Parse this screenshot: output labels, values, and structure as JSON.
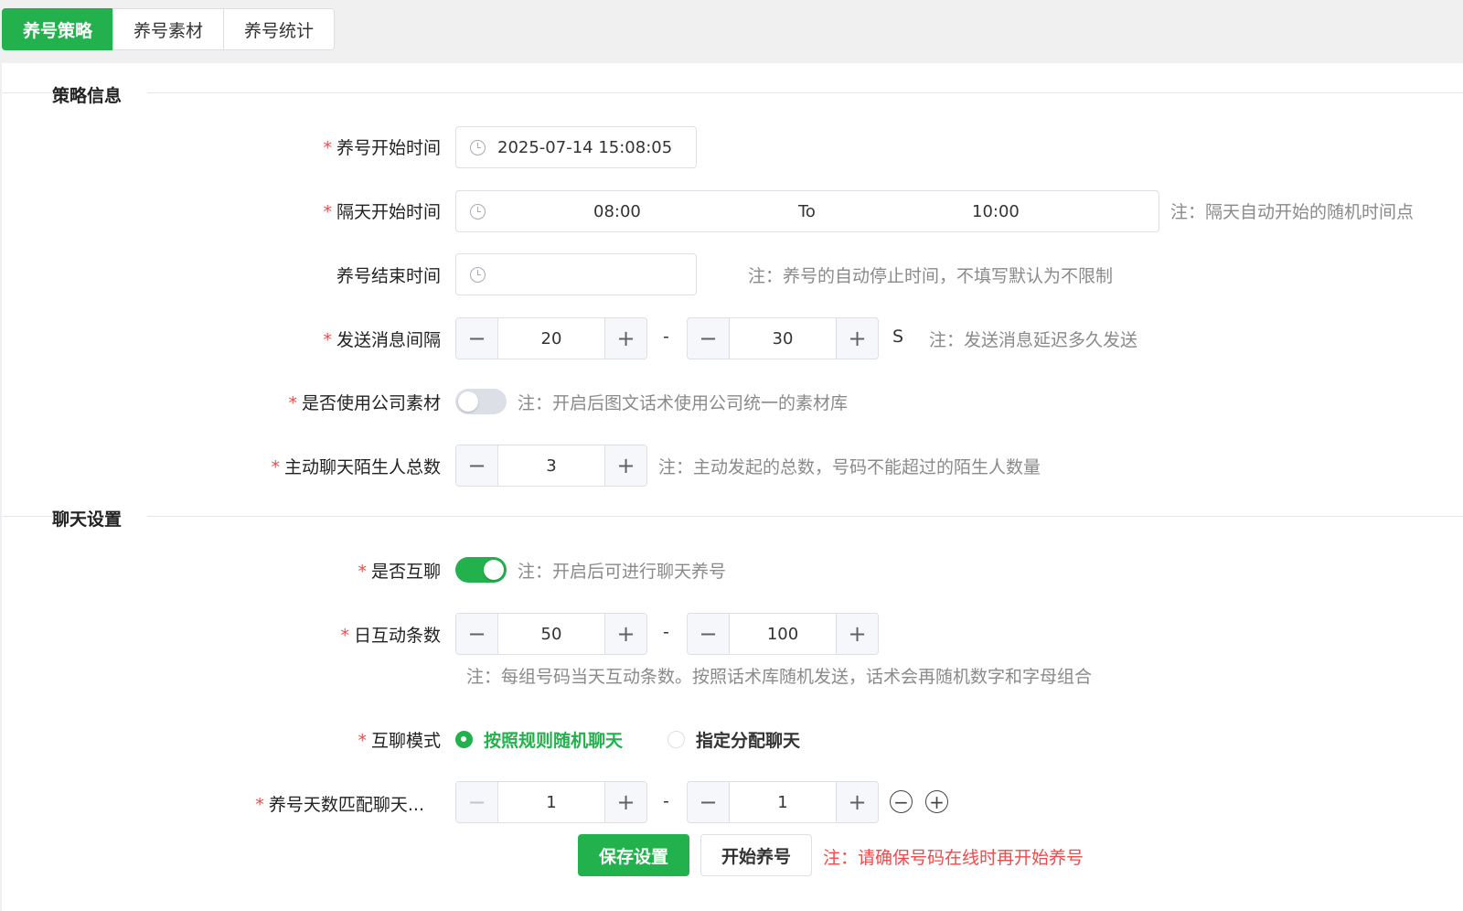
{
  "tabs": [
    "养号策略",
    "养号素材",
    "养号统计"
  ],
  "sections": {
    "strategy": "策略信息",
    "chat": "聊天设置"
  },
  "colors": {
    "accent": "#22b14c",
    "required": "#f04a4a",
    "note": "#8a8a8a"
  },
  "icons": {
    "clock": "clock-icon",
    "minus": "minus-icon",
    "plus": "plus-icon",
    "remove": "minus-circle-icon",
    "add": "plus-circle-icon"
  },
  "fields": {
    "start_time": {
      "label": "养号开始时间",
      "value": "2025-07-14 15:08:05"
    },
    "next_day": {
      "label": "隔天开始时间",
      "from": "08:00",
      "to_sep": "To",
      "to": "10:00",
      "note": "注：隔天自动开始的随机时间点"
    },
    "end_time": {
      "label": "养号结束时间",
      "value": "",
      "note": "注：养号的自动停止时间，不填写默认为不限制"
    },
    "interval": {
      "label": "发送消息间隔",
      "min": "20",
      "max": "30",
      "unit": "S",
      "note": "注：发送消息延迟多久发送",
      "dash": "-"
    },
    "company_material": {
      "label": "是否使用公司素材",
      "enabled": false,
      "note": "注：开启后图文话术使用公司统一的素材库"
    },
    "stranger_total": {
      "label": "主动聊天陌生人总数",
      "value": "3",
      "note": "注：主动发起的总数，号码不能超过的陌生人数量"
    },
    "mutual_chat": {
      "label": "是否互聊",
      "enabled": true,
      "note": "注：开启后可进行聊天养号"
    },
    "daily_count": {
      "label": "日互动条数",
      "min": "50",
      "max": "100",
      "dash": "-",
      "note": "注：每组号码当天互动条数。按照话术库随机发送，话术会再随机数字和字母组合"
    },
    "chat_mode": {
      "label": "互聊模式",
      "options": [
        "按照规则随机聊天",
        "指定分配聊天"
      ],
      "selected": 0
    },
    "day_match": {
      "label": "养号天数匹配聊天...",
      "min": "1",
      "max": "1",
      "dash": "-"
    }
  },
  "actions": {
    "save": "保存设置",
    "start": "开始养号",
    "warning": "注：请确保号码在线时再开始养号"
  },
  "step": {
    "minus": "−",
    "plus": "+"
  }
}
